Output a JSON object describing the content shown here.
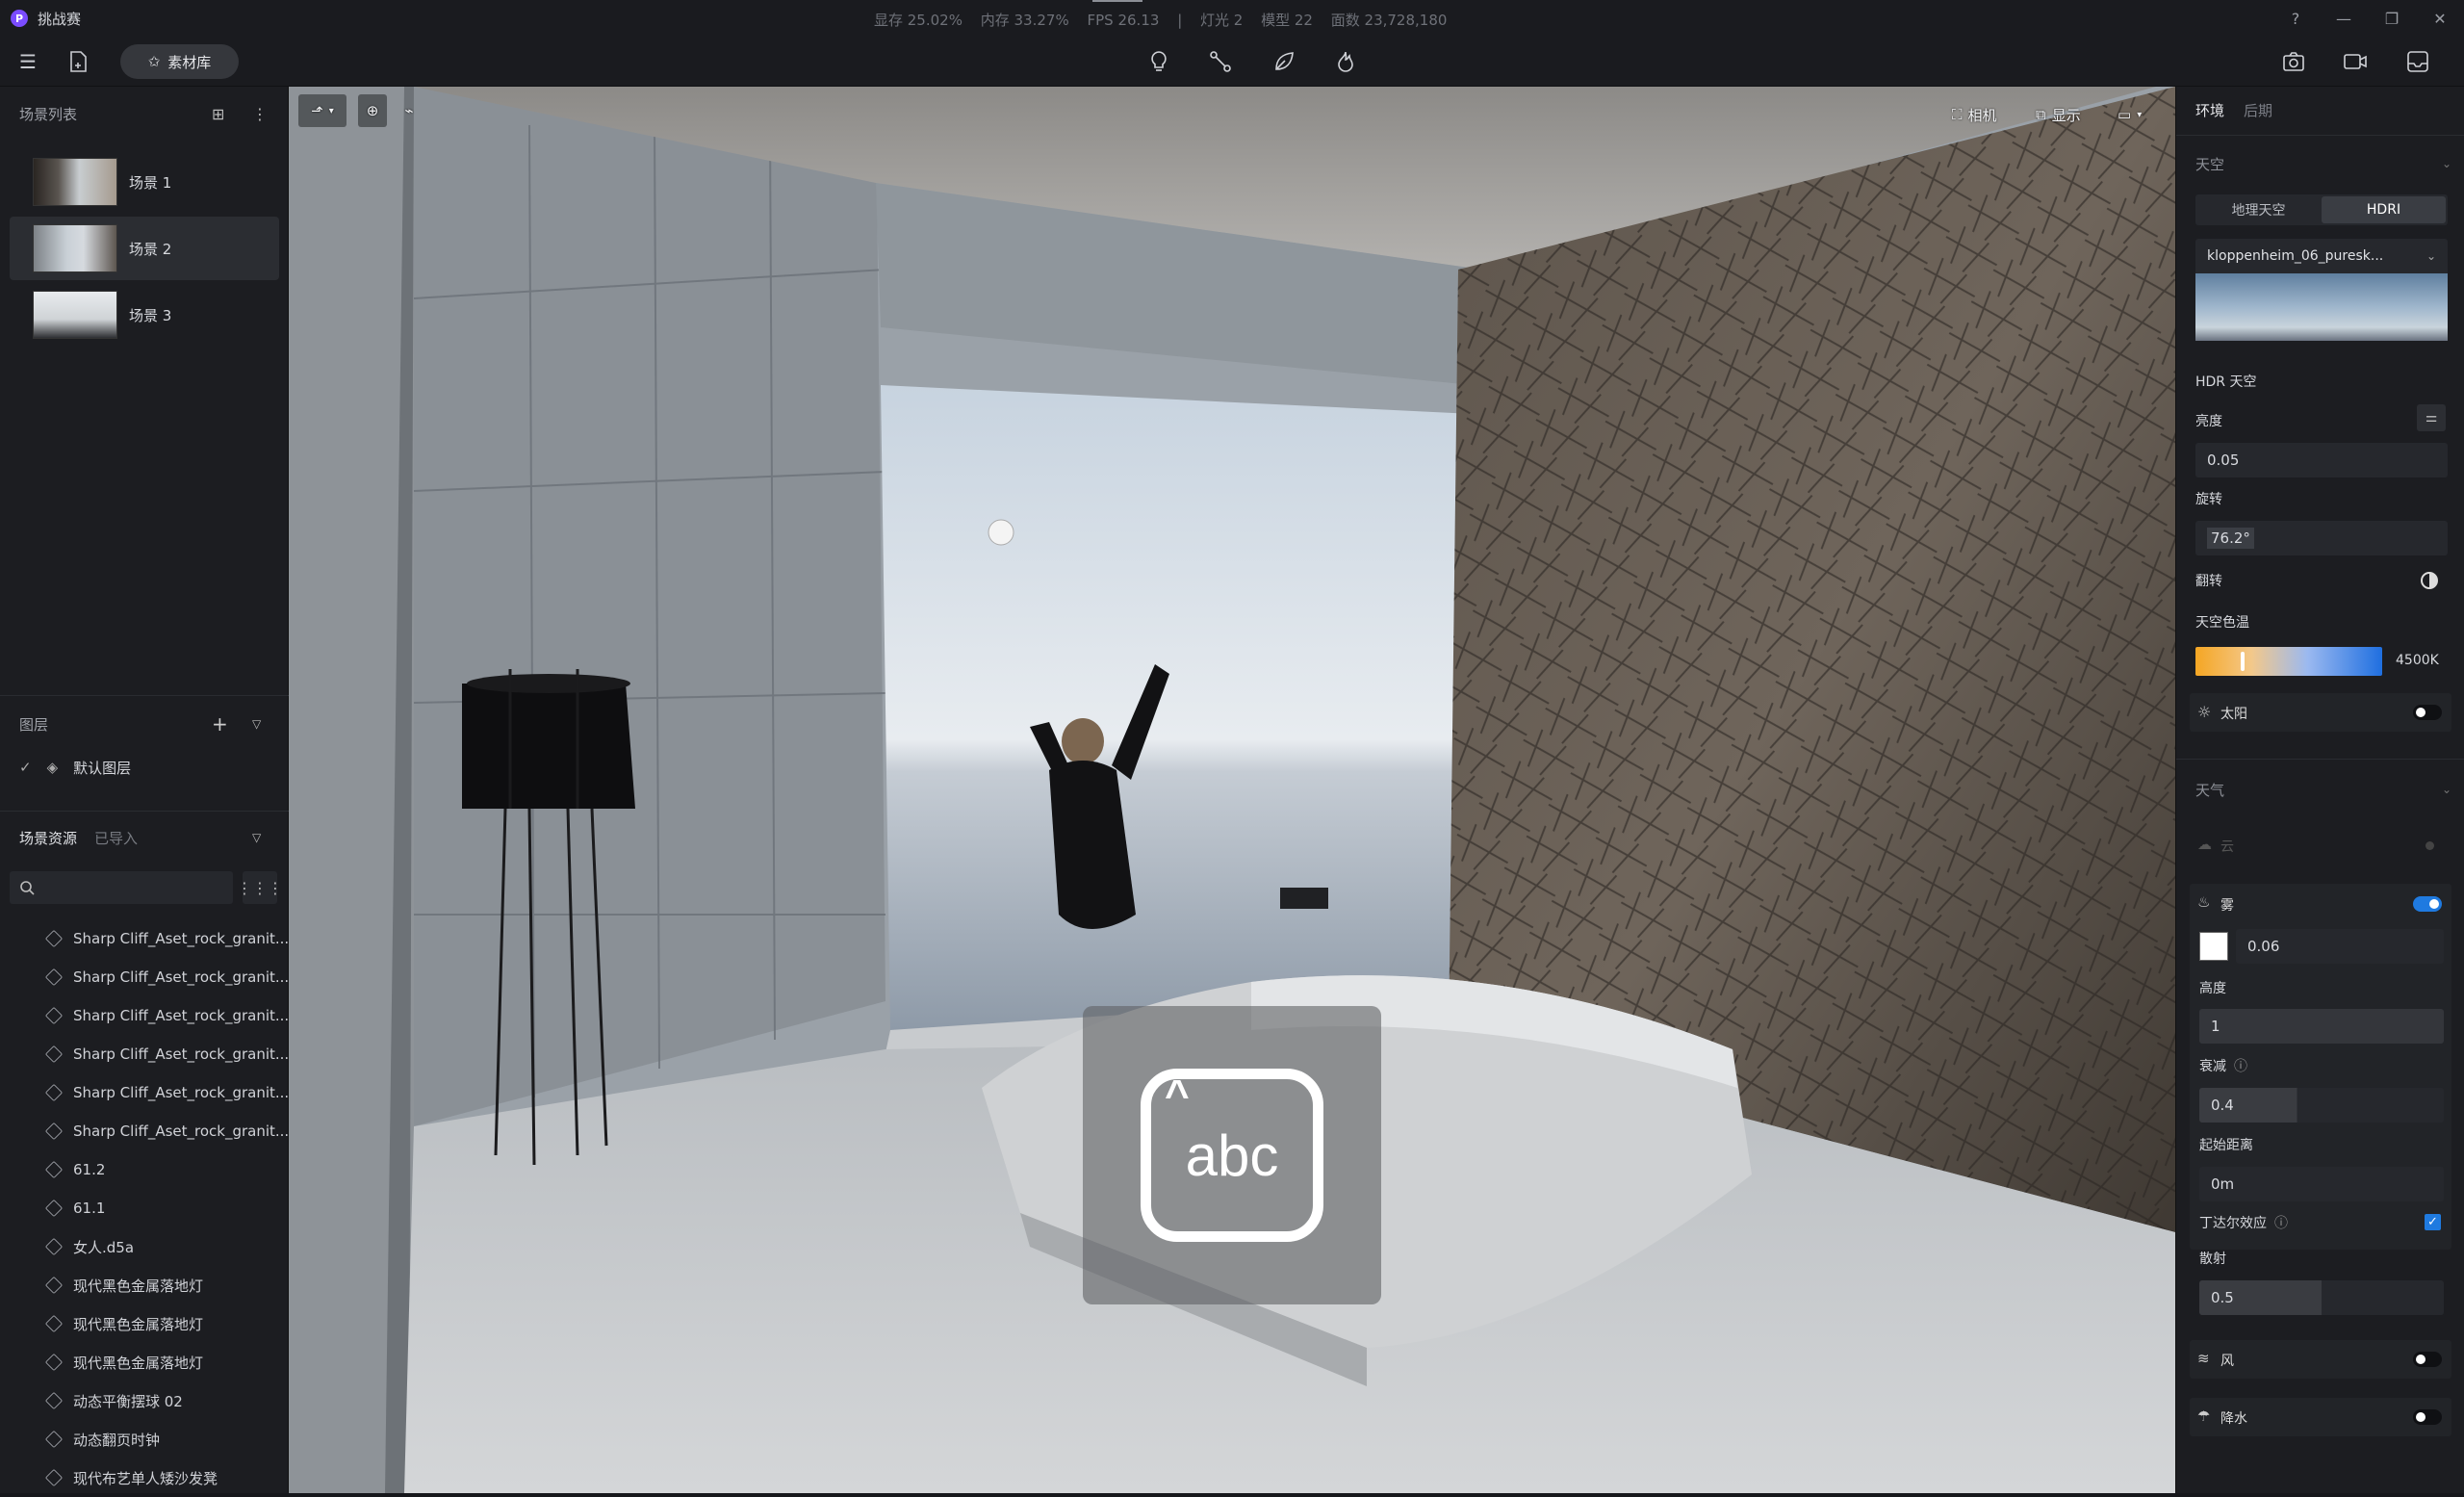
{
  "app": {
    "name": "挑战赛",
    "logo_letter": "P"
  },
  "stats": {
    "vram": "显存 25.02%",
    "memory": "内存 33.27%",
    "fps": "FPS 26.13",
    "sep": "|",
    "lights": "灯光 2",
    "models": "模型 22",
    "faces": "面数 23,728,180"
  },
  "toolbar": {
    "library_label": "素材库"
  },
  "scene_list": {
    "title": "场景列表",
    "items": [
      {
        "label": "场景 1"
      },
      {
        "label": "场景 2"
      },
      {
        "label": "场景 3"
      }
    ]
  },
  "layers": {
    "title": "图层",
    "items": [
      {
        "label": "默认图层"
      }
    ]
  },
  "assets": {
    "tab_active": "场景资源",
    "tab_other": "已导入",
    "items": [
      {
        "label": "Sharp Cliff_Aset_rock_granit..."
      },
      {
        "label": "Sharp Cliff_Aset_rock_granit..."
      },
      {
        "label": "Sharp Cliff_Aset_rock_granit..."
      },
      {
        "label": "Sharp Cliff_Aset_rock_granit..."
      },
      {
        "label": "Sharp Cliff_Aset_rock_granit..."
      },
      {
        "label": "Sharp Cliff_Aset_rock_granit..."
      },
      {
        "label": "61.2"
      },
      {
        "label": "61.1"
      },
      {
        "label": "女人.d5a"
      },
      {
        "label": "现代黑色金属落地灯"
      },
      {
        "label": "现代黑色金属落地灯"
      },
      {
        "label": "现代黑色金属落地灯"
      },
      {
        "label": "动态平衡摆球 02"
      },
      {
        "label": "动态翻页时钟"
      },
      {
        "label": "现代布艺单人矮沙发凳"
      }
    ]
  },
  "viewport": {
    "camera_label": "相机",
    "display_label": "显示",
    "keyboard_text": "abc"
  },
  "right_panel": {
    "tab_env": "环境",
    "tab_post": "后期",
    "sky": {
      "title": "天空",
      "mode_geo": "地理天空",
      "mode_hdri": "HDRI",
      "hdri_file": "kloppenheim_06_puresk...",
      "hdr_sky": "HDR 天空",
      "brightness_label": "亮度",
      "brightness_value": "0.05",
      "rotation_label": "旋转",
      "rotation_value": "76.2°",
      "flip_label": "翻转",
      "color_temp_label": "天空色温",
      "color_temp_value": "4500K",
      "sun_label": "太阳"
    },
    "weather": {
      "title": "天气",
      "cloud_label": "云",
      "fog_label": "雾",
      "fog_value": "0.06",
      "height_label": "高度",
      "height_value": "1",
      "decay_label": "衰减",
      "decay_value": "0.4",
      "start_label": "起始距离",
      "start_value": "0m",
      "tyndall_label": "丁达尔效应",
      "scatter_label": "散射",
      "scatter_value": "0.5",
      "wind_label": "风",
      "rain_label": "降水"
    }
  }
}
